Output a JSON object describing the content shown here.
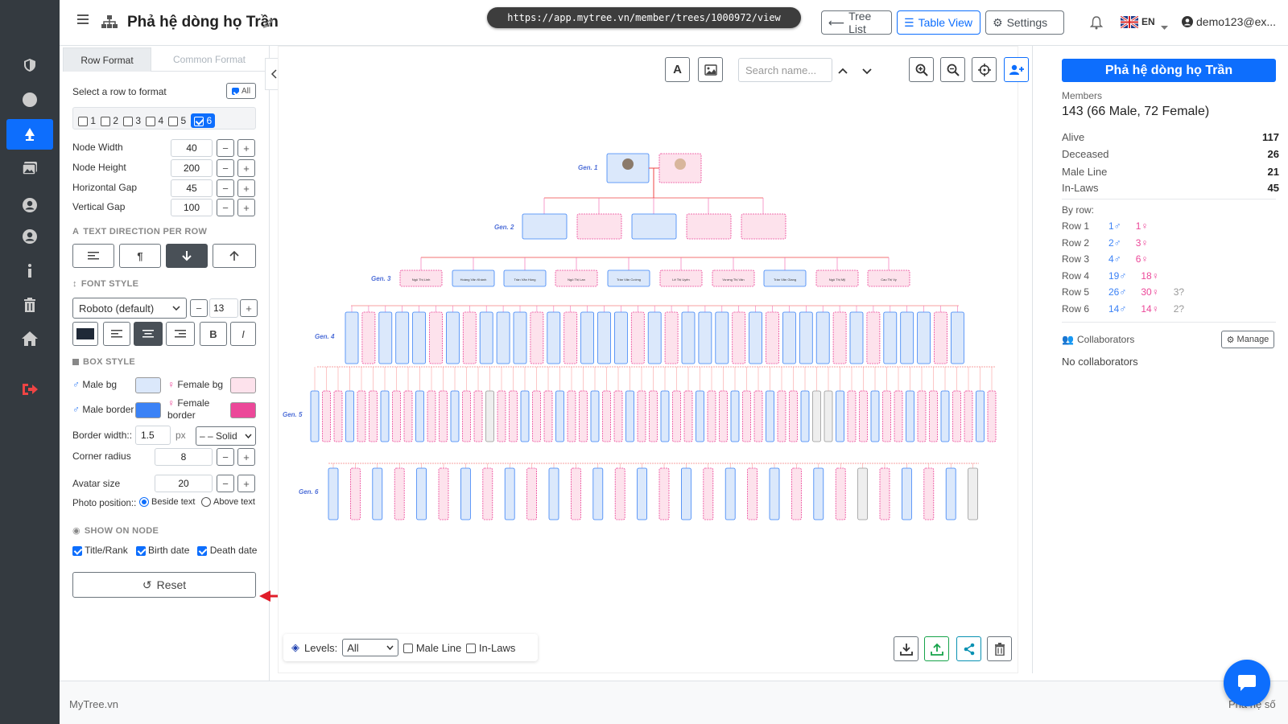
{
  "url": "https://app.mytree.vn/member/trees/1000972/view",
  "header": {
    "title": "Phả hệ dòng họ Trần",
    "tree_list": "Tree List",
    "table_view": "Table View",
    "settings": "Settings",
    "lang": "EN",
    "user": "demo123@ex..."
  },
  "left_panel": {
    "tabs": [
      "Row Format",
      "Common Format"
    ],
    "select_row": "Select a row to format",
    "all_label": "All",
    "rows": [
      "1",
      "2",
      "3",
      "4",
      "5",
      "6"
    ],
    "selected_row": "6",
    "node_width_label": "Node Width",
    "node_width": "40",
    "node_height_label": "Node Height",
    "node_height": "200",
    "hgap_label": "Horizontal Gap",
    "hgap": "45",
    "vgap_label": "Vertical Gap",
    "vgap": "100",
    "text_direction": "TEXT DIRECTION PER ROW",
    "font_style": "FONT STYLE",
    "font": "Roboto (default)",
    "font_size": "13",
    "bold": "B",
    "italic": "I",
    "box_style": "BOX STYLE",
    "male_bg": "Male bg",
    "female_bg": "Female bg",
    "male_border": "Male border",
    "female_border": "Female border",
    "border_width_label": "Border width::",
    "border_width": "1.5",
    "border_unit": "px",
    "border_style": "– – Solid",
    "corner_radius_label": "Corner radius",
    "corner_radius": "8",
    "avatar_size_label": "Avatar size",
    "avatar_size": "20",
    "photo_position_label": "Photo position::",
    "beside_text": "Beside text",
    "above_text": "Above text",
    "show_on_node": "SHOW ON NODE",
    "title_rank": "Title/Rank",
    "birth_date": "Birth date",
    "death_date": "Death date",
    "reset": "Reset",
    "colors": {
      "male_bg": "#dbe8fb",
      "female_bg": "#fde2ec",
      "male_border": "#3b82f6",
      "female_border": "#ec4899"
    }
  },
  "canvas": {
    "search_placeholder": "Search name...",
    "levels_label": "Levels:",
    "levels_value": "All",
    "male_line": "Male Line",
    "in_laws": "In-Laws",
    "gen_labels": [
      "Gen. 1",
      "Gen. 2",
      "Gen. 3",
      "Gen. 4",
      "Gen. 5",
      "Gen. 6"
    ],
    "gen3_names": [
      "Ngô Thị Linh",
      "Hoàng Văn Khánh",
      "Trần Văn Hùng",
      "Ngô Thị Lan",
      "Trần Văn Cường",
      "Lê Thị Uyên",
      "Vương Thị Vân",
      "Trần Văn Giang",
      "Ngô Thị Mỹ",
      "Cao Thị Vy"
    ]
  },
  "right_panel": {
    "title": "Phả hệ dòng họ Trần",
    "members_label": "Members",
    "members_value": "143 (66 Male, 72 Female)",
    "alive_label": "Alive",
    "alive": "117",
    "deceased_label": "Deceased",
    "deceased": "26",
    "male_line_label": "Male Line",
    "male_line": "21",
    "in_laws_label": "In-Laws",
    "in_laws": "45",
    "by_row_label": "By row:",
    "rows": [
      {
        "label": "Row 1",
        "male": "1♂",
        "female": "1♀",
        "unknown": ""
      },
      {
        "label": "Row 2",
        "male": "2♂",
        "female": "3♀",
        "unknown": ""
      },
      {
        "label": "Row 3",
        "male": "4♂",
        "female": "6♀",
        "unknown": ""
      },
      {
        "label": "Row 4",
        "male": "19♂",
        "female": "18♀",
        "unknown": ""
      },
      {
        "label": "Row 5",
        "male": "26♂",
        "female": "30♀",
        "unknown": "3?"
      },
      {
        "label": "Row 6",
        "male": "14♂",
        "female": "14♀",
        "unknown": "2?"
      }
    ],
    "collaborators": "Collaborators",
    "manage": "Manage",
    "no_collaborators": "No collaborators"
  },
  "footer": {
    "left": "MyTree.vn",
    "right": "Phả hệ số"
  }
}
